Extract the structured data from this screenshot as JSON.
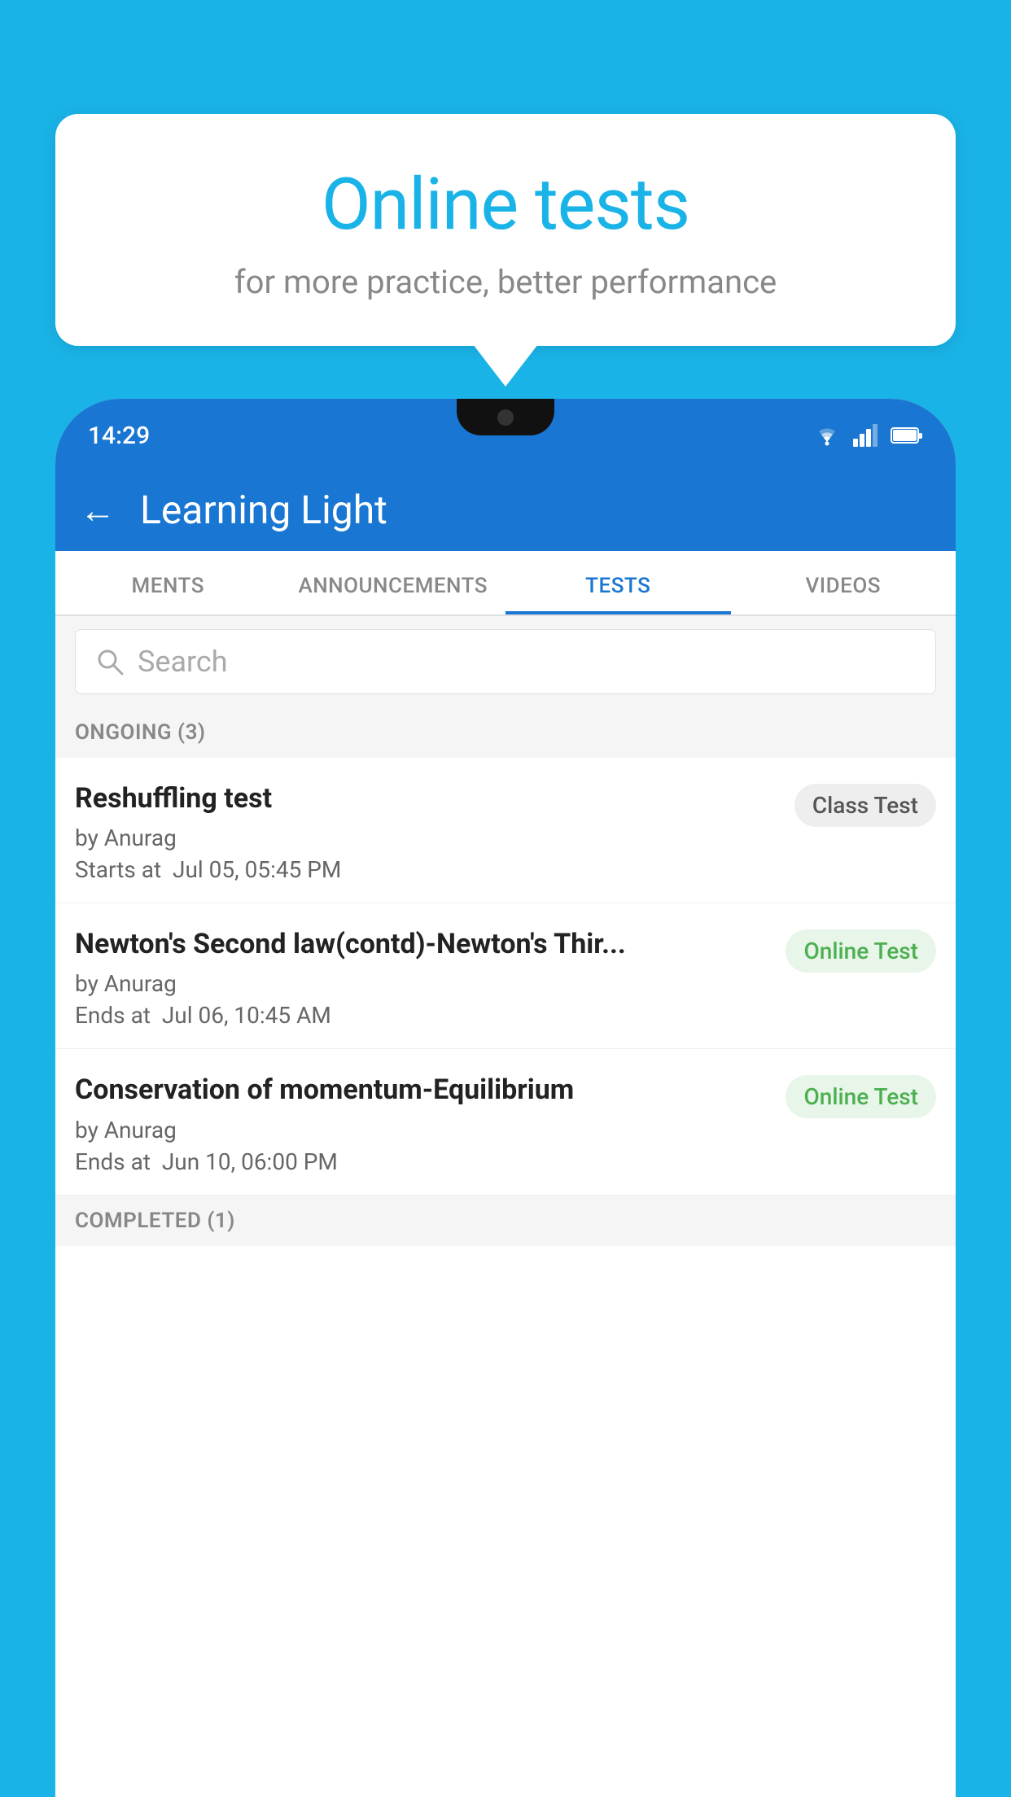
{
  "background_color": "#1ab3e8",
  "speech_bubble": {
    "title": "Online tests",
    "subtitle": "for more practice, better performance"
  },
  "phone": {
    "status_bar": {
      "time": "14:29"
    },
    "header": {
      "title": "Learning Light",
      "back_label": "←"
    },
    "tabs": [
      {
        "label": "MENTS",
        "active": false
      },
      {
        "label": "ANNOUNCEMENTS",
        "active": false
      },
      {
        "label": "TESTS",
        "active": true
      },
      {
        "label": "VIDEOS",
        "active": false
      }
    ],
    "search": {
      "placeholder": "Search"
    },
    "sections": [
      {
        "header": "ONGOING (3)",
        "items": [
          {
            "title": "Reshuffling test",
            "by": "by Anurag",
            "time_label": "Starts at",
            "time": "Jul 05, 05:45 PM",
            "badge": "Class Test",
            "badge_type": "class"
          },
          {
            "title": "Newton's Second law(contd)-Newton's Thir...",
            "by": "by Anurag",
            "time_label": "Ends at",
            "time": "Jul 06, 10:45 AM",
            "badge": "Online Test",
            "badge_type": "online"
          },
          {
            "title": "Conservation of momentum-Equilibrium",
            "by": "by Anurag",
            "time_label": "Ends at",
            "time": "Jun 10, 06:00 PM",
            "badge": "Online Test",
            "badge_type": "online"
          }
        ]
      },
      {
        "header": "COMPLETED (1)",
        "items": []
      }
    ]
  }
}
